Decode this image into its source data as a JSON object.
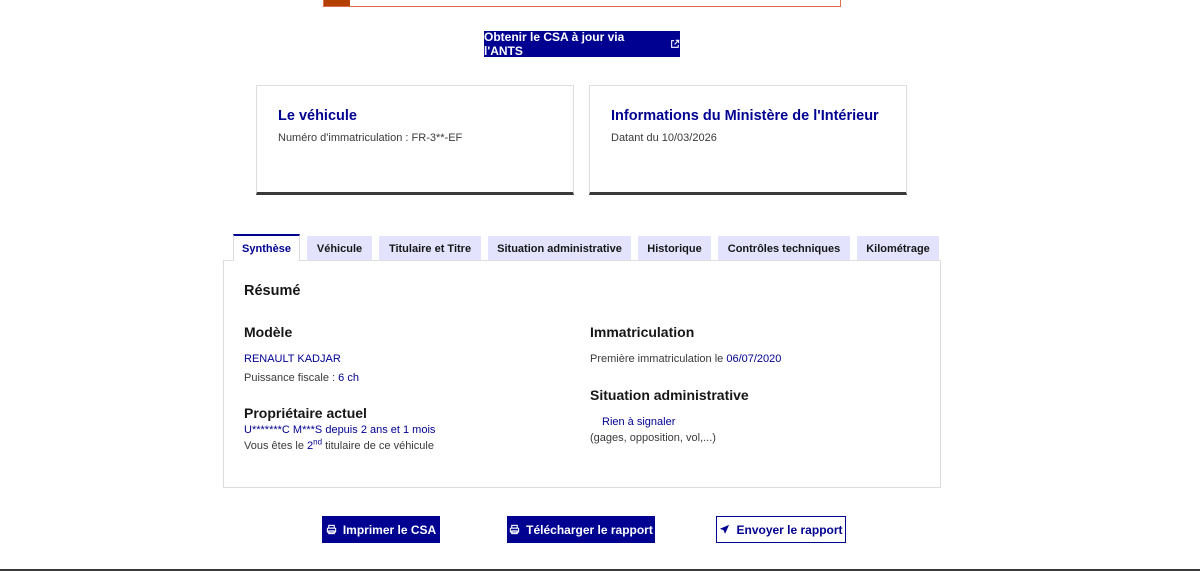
{
  "ants_button": {
    "label": "Obtenir le CSA à jour via l'ANTS"
  },
  "cards": {
    "vehicle": {
      "title": "Le véhicule",
      "subtitle": "Numéro d'immatriculation : FR-3**-EF"
    },
    "ministry": {
      "title": "Informations du Ministère de l'Intérieur",
      "subtitle": "Datant du 10/03/2026"
    }
  },
  "tabs": [
    {
      "label": "Synthèse"
    },
    {
      "label": "Véhicule"
    },
    {
      "label": "Titulaire et Titre"
    },
    {
      "label": "Situation administrative"
    },
    {
      "label": "Historique"
    },
    {
      "label": "Contrôles techniques"
    },
    {
      "label": "Kilométrage"
    }
  ],
  "summary": {
    "heading": "Résumé",
    "model": {
      "heading": "Modèle",
      "name": "RENAULT KADJAR",
      "power_label": "Puissance fiscale :",
      "power_value": "6 ch"
    },
    "owner": {
      "heading": "Propriétaire actuel",
      "name": "U*******C M***S",
      "since_label": "depuis",
      "since_value": "2 ans et 1 mois",
      "rank_prefix": "Vous êtes le",
      "rank_value": "2",
      "rank_suffix": "nd",
      "rank_end": "titulaire de ce véhicule"
    },
    "registration": {
      "heading": "Immatriculation",
      "first_label": "Première immatriculation le",
      "first_date": "06/07/2020"
    },
    "admin": {
      "heading": "Situation administrative",
      "status": "Rien à signaler",
      "details": "(gages, opposition, vol,...)"
    }
  },
  "footer": {
    "print": "Imprimer le CSA",
    "download": "Télécharger le rapport",
    "send": "Envoyer le rapport"
  },
  "colors": {
    "primary": "#000091",
    "tab_bg": "#e3e3fd",
    "alert": "#b34000"
  }
}
